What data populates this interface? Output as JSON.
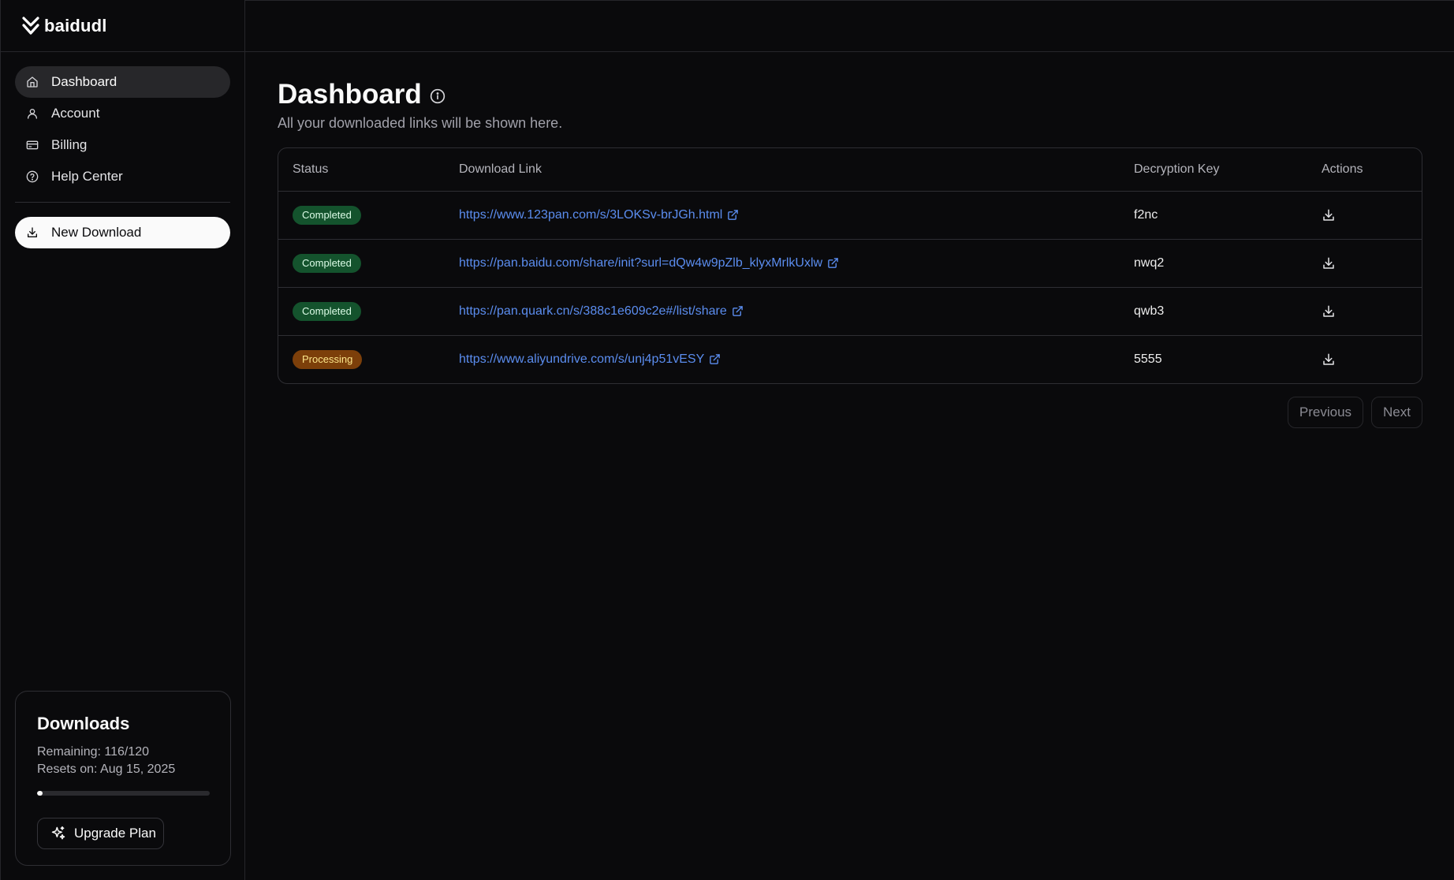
{
  "app": {
    "name": "baidudl"
  },
  "sidebar": {
    "items": [
      {
        "label": "Dashboard",
        "icon": "home-icon"
      },
      {
        "label": "Account",
        "icon": "user-icon"
      },
      {
        "label": "Billing",
        "icon": "credit-card-icon"
      },
      {
        "label": "Help Center",
        "icon": "help-circle-icon"
      }
    ],
    "new_download_label": "New Download"
  },
  "quota": {
    "title": "Downloads",
    "remaining_text": "Remaining: 116/120",
    "resets_text": "Resets on: Aug 15, 2025",
    "used_fraction": 0.033,
    "upgrade_label": "Upgrade Plan"
  },
  "page": {
    "title": "Dashboard",
    "subtitle": "All your downloaded links will be shown here."
  },
  "table": {
    "columns": [
      "Status",
      "Download Link",
      "Decryption Key",
      "Actions"
    ],
    "rows": [
      {
        "status": "Completed",
        "link": "https://www.123pan.com/s/3LOKSv-brJGh.html",
        "key": "f2nc"
      },
      {
        "status": "Completed",
        "link": "https://pan.baidu.com/share/init?surl=dQw4w9pZlb_klyxMrlkUxlw",
        "key": "nwq2"
      },
      {
        "status": "Completed",
        "link": "https://pan.quark.cn/s/388c1e609c2e#/list/share",
        "key": "qwb3"
      },
      {
        "status": "Processing",
        "link": "https://www.aliyundrive.com/s/unj4p51vESY",
        "key": "5555"
      }
    ]
  },
  "pagination": {
    "previous_label": "Previous",
    "next_label": "Next"
  },
  "colors": {
    "background": "#0a0a0c",
    "completed_badge": "#14532d",
    "processing_badge": "#7c3f0a",
    "link": "#5b8def"
  }
}
